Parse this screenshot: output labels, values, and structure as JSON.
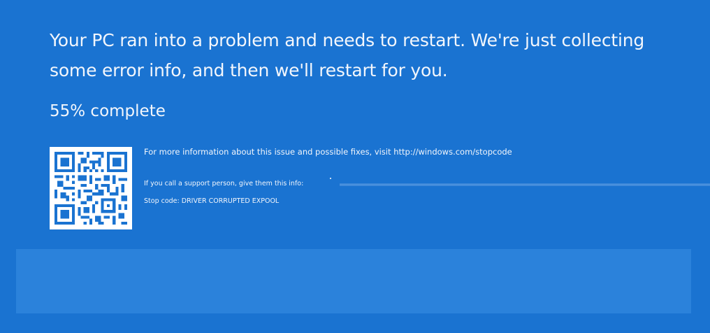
{
  "message": "Your PC ran into a problem and needs to restart. We're just collecting some error info, and then we'll restart for you.",
  "progress": {
    "text": "55% complete",
    "percent": 55
  },
  "more_info": {
    "text": "For more information about this issue and possible fixes, visit http://windows.com/stopcode"
  },
  "support": {
    "text": "If you call a support person, give them this info:"
  },
  "stop_code": {
    "text": "Stop code: DRIVER CORRUPTED EXPOOL"
  },
  "colors": {
    "background": "#1a73d1",
    "text": "#f2f6fc",
    "qr_dark": "#1a73d1",
    "qr_light": "#ffffff"
  }
}
